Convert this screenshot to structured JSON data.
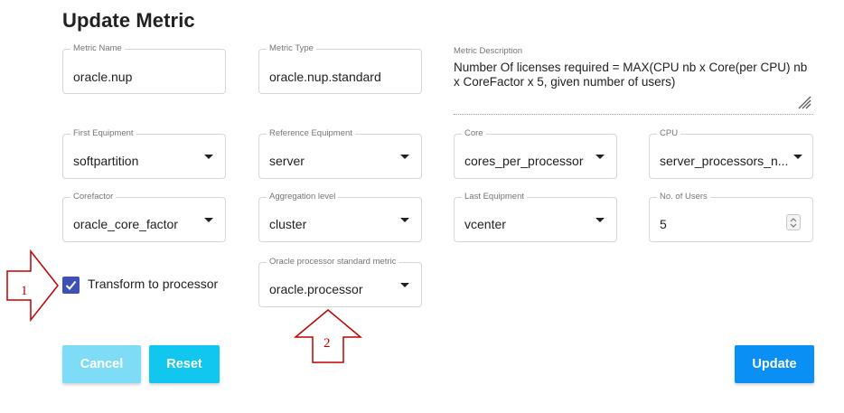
{
  "page": {
    "title": "Update Metric"
  },
  "fields": {
    "metric_name": {
      "label": "Metric Name",
      "value": "oracle.nup"
    },
    "metric_type": {
      "label": "Metric Type",
      "value": "oracle.nup.standard"
    },
    "metric_description": {
      "label": "Metric Description",
      "value": "Number Of licenses required = MAX(CPU nb x Core(per CPU) nb x CoreFactor x 5, given number of users)"
    },
    "first_equipment": {
      "label": "First Equipment",
      "value": "softpartition"
    },
    "reference_equipment": {
      "label": "Reference Equipment",
      "value": "server"
    },
    "core": {
      "label": "Core",
      "value": "cores_per_processor"
    },
    "cpu": {
      "label": "CPU",
      "value": "server_processors_n..."
    },
    "corefactor": {
      "label": "Corefactor",
      "value": "oracle_core_factor"
    },
    "aggregation_level": {
      "label": "Aggregation level",
      "value": "cluster"
    },
    "last_equipment": {
      "label": "Last Equipment",
      "value": "vcenter"
    },
    "no_of_users": {
      "label": "No. of Users",
      "value": "5"
    },
    "oracle_processor_metric": {
      "label": "Oracle processor standard metric",
      "value": "oracle.processor"
    }
  },
  "transform_checkbox": {
    "label": "Transform to processor",
    "checked": true
  },
  "buttons": {
    "cancel": "Cancel",
    "reset": "Reset",
    "update": "Update"
  },
  "annotations": {
    "arrow_1": "1",
    "arrow_2": "2"
  },
  "colors": {
    "checkbox": "#3f51b5",
    "cancel_button": "#7fdcf7",
    "reset_button": "#12c7ef",
    "update_button": "#0a8ff5",
    "annotation_arrow": "#c00000"
  }
}
